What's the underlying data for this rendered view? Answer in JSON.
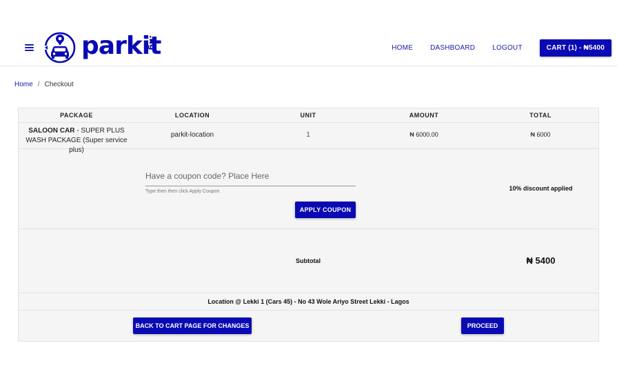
{
  "brand": {
    "logo_text": "parkit",
    "logo_tld": ".ng",
    "accent_color": "#0a0ab4",
    "logo_icon": "car-location-icon"
  },
  "nav": {
    "menu_icon": "hamburger-icon",
    "links": [
      "HOME",
      "DASHBOARD",
      "LOGOUT"
    ],
    "cart_label": "CART (1) - ₦5400"
  },
  "breadcrumb": {
    "home": "Home",
    "separator": "/",
    "current": "Checkout"
  },
  "table": {
    "headers": [
      "PACKAGE",
      "LOCATION",
      "UNIT",
      "AMOUNT",
      "TOTAL"
    ],
    "item": {
      "package_strong": "SALOON CAR",
      "package_rest": " - SUPER PLUS WASH PACKAGE (Super service plus)",
      "location": "parkit-location",
      "unit": "1",
      "amount": "₦ 6000.00",
      "total": "₦ 6000"
    },
    "coupon": {
      "placeholder": "Have a coupon code? Place Here",
      "hint": "Type then then click Apply Coupon",
      "button": "APPLY COUPON",
      "discount_note": "10% discount applied"
    },
    "subtotal": {
      "label": "Subtotal",
      "value": "₦ 5400"
    },
    "location_line": "Location @ Lekki 1 (Cars 45) - No 43 Wole Ariyo Street Lekki - Lagos",
    "actions": {
      "back": "BACK TO CART PAGE FOR CHANGES",
      "proceed": "PROCEED"
    }
  }
}
